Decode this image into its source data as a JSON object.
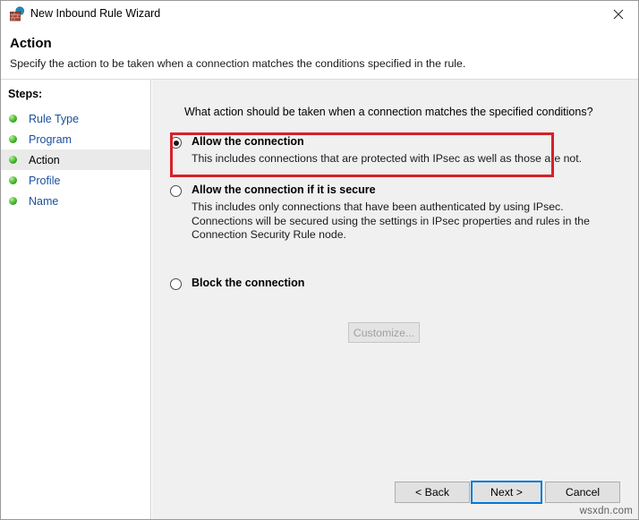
{
  "window": {
    "title": "New Inbound Rule Wizard",
    "icon": "firewall-globe-icon",
    "close_label": "close-icon"
  },
  "header": {
    "title": "Action",
    "subtitle": "Specify the action to be taken when a connection matches the conditions specified in the rule."
  },
  "sidebar": {
    "heading": "Steps:",
    "items": [
      {
        "label": "Rule Type",
        "state": "completed"
      },
      {
        "label": "Program",
        "state": "completed"
      },
      {
        "label": "Action",
        "state": "current"
      },
      {
        "label": "Profile",
        "state": "completed"
      },
      {
        "label": "Name",
        "state": "completed"
      }
    ]
  },
  "main": {
    "question": "What action should be taken when a connection matches the specified conditions?",
    "options": [
      {
        "title": "Allow the connection",
        "description": "This includes connections that are protected with IPsec as well as those are not.",
        "selected": true
      },
      {
        "title": "Allow the connection if it is secure",
        "description": "This includes only connections that have been authenticated by using IPsec.  Connections will be secured using the settings in IPsec properties and rules in the Connection Security Rule node.",
        "selected": false
      },
      {
        "title": "Block the connection",
        "description": "",
        "selected": false
      }
    ],
    "customize_label": "Customize...",
    "customize_enabled": false
  },
  "footer": {
    "back_label": "< Back",
    "next_label": "Next >",
    "cancel_label": "Cancel"
  },
  "annotation": {
    "highlight_color": "#d6212b",
    "highlights": "allow-the-connection-option"
  },
  "watermark": {
    "text": "wsxdn.com"
  }
}
